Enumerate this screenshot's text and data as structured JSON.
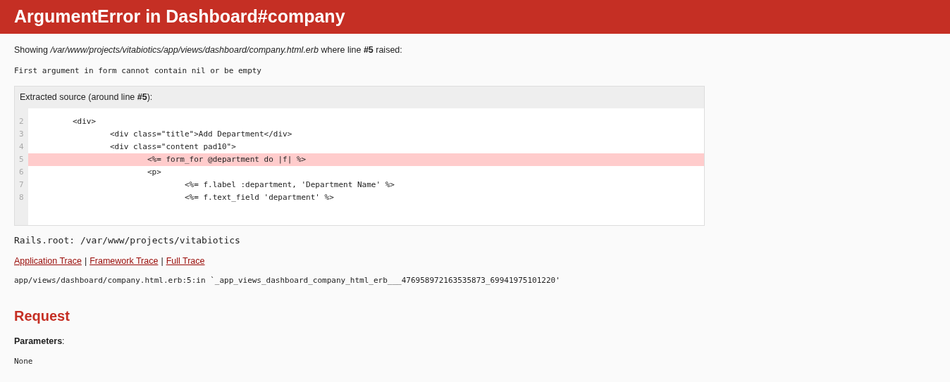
{
  "header": {
    "title": "ArgumentError in Dashboard#company"
  },
  "showing": "Showing */var/www/projects/vitabiotics/app/views/dashboard/company.html.erb* where line **#5** raised:",
  "message": "First argument in form cannot contain nil or be empty",
  "source": {
    "heading": "Extracted source (around line **#5**):",
    "lines": [
      {
        "number": "2",
        "code": "\t<div>",
        "highlighted": false
      },
      {
        "number": "3",
        "code": "\t\t<div class=\"title\">Add Department</div>",
        "highlighted": false
      },
      {
        "number": "4",
        "code": "\t\t<div class=\"content pad10\">",
        "highlighted": false
      },
      {
        "number": "5",
        "code": "\t\t\t<%= form_for @department do |f| %>",
        "highlighted": true
      },
      {
        "number": "6",
        "code": "\t\t\t<p>",
        "highlighted": false
      },
      {
        "number": "7",
        "code": "\t\t\t\t<%= f.label :department, 'Department Name' %>",
        "highlighted": false
      },
      {
        "number": "8",
        "code": "\t\t\t\t<%= f.text_field 'department' %>",
        "highlighted": false
      }
    ]
  },
  "rails_root": "Rails.root: /var/www/projects/vitabiotics",
  "trace_links": [
    "Application Trace",
    "Framework Trace",
    "Full Trace"
  ],
  "trace_separators": [
    "|",
    "|"
  ],
  "trace_line": "app/views/dashboard/company.html.erb:5:in `_app_views_dashboard_company_html_erb___476958972163535873_69941975101220'",
  "request": {
    "heading": "Request",
    "parameters_label": "**Parameters**:",
    "parameters_value": "None"
  }
}
